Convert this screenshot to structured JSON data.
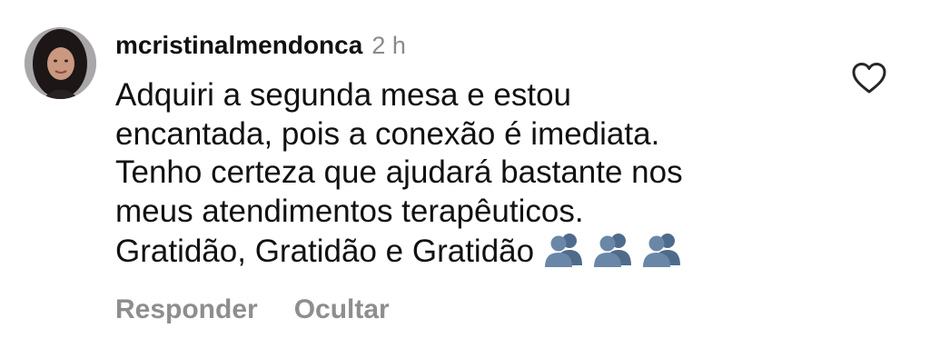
{
  "comment": {
    "username": "mcristinalmendonca",
    "time": "2 h",
    "lines": [
      "Adquiri a segunda mesa e estou",
      "encantada, pois a conexão é imediata.",
      "Tenho certeza que ajudará bastante nos",
      "meus atendimentos terapêuticos.",
      "Gratidão, Gratidão e Gratidão"
    ],
    "emojis": [
      "busts-in-silhouette-icon",
      "busts-in-silhouette-icon",
      "busts-in-silhouette-icon"
    ],
    "actions": {
      "reply_label": "Responder",
      "hide_label": "Ocultar"
    },
    "icons": {
      "like": "heart-outline-icon"
    },
    "colors": {
      "text": "#111111",
      "muted": "#8e8e8e",
      "emoji": "#5a7594"
    }
  }
}
